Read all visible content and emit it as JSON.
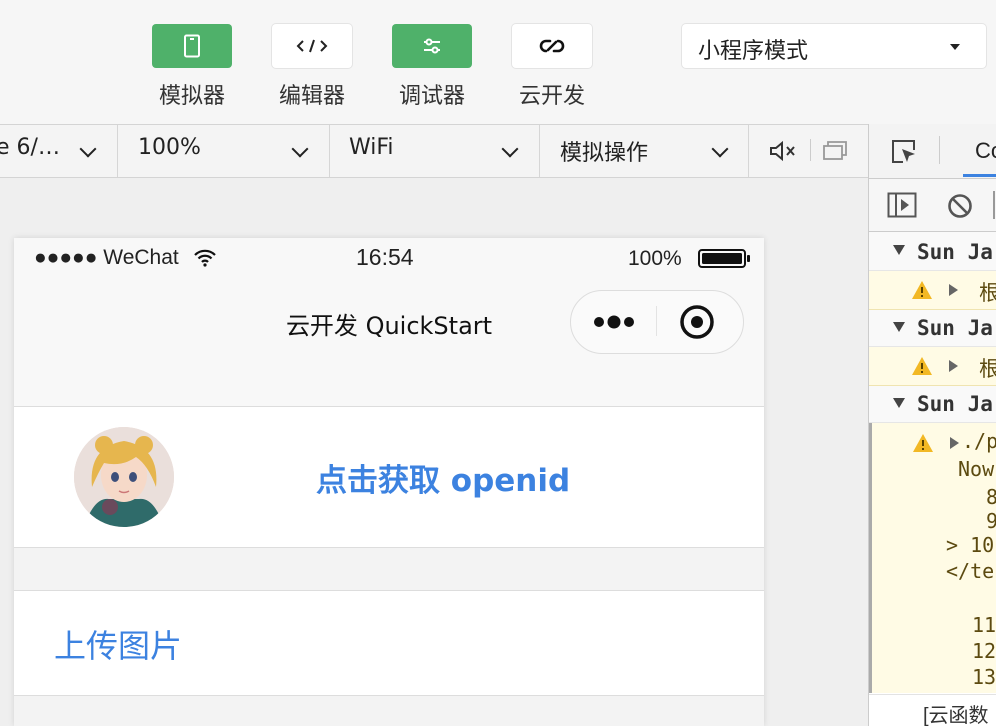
{
  "toolbar": {
    "tools": [
      {
        "label": "模拟器",
        "icon": "phone-icon",
        "active": true
      },
      {
        "label": "编辑器",
        "icon": "code-icon",
        "active": false
      },
      {
        "label": "调试器",
        "icon": "sliders-icon",
        "active": true
      },
      {
        "label": "云开发",
        "icon": "cloud-link-icon",
        "active": false
      }
    ],
    "mode_select": "小程序模式"
  },
  "subbar": {
    "device": "e 6/…",
    "zoom": "100%",
    "network": "WiFi",
    "operation": "模拟操作"
  },
  "phone": {
    "status": {
      "carrier": "●●●●● WeChat",
      "time": "16:54",
      "battery": "100%"
    },
    "nav_title": "云开发 QuickStart",
    "openid_button": "点击获取 openid",
    "upload_link": "上传图片"
  },
  "devtools": {
    "tab_label": "Co",
    "logs": [
      {
        "label": "Sun Ja",
        "child": "根"
      },
      {
        "label": "Sun Ja",
        "child": "根"
      },
      {
        "label": "Sun Ja"
      }
    ],
    "code_lines": [
      "./p",
      "Now",
      "8",
      "9",
      "> 10",
      "</te",
      "11",
      "12",
      "13"
    ],
    "footer": "[云函数"
  },
  "colors": {
    "accent_green": "#4fb16a",
    "link_blue": "#3c82e0",
    "warning_yellow": "#fffbe5"
  }
}
